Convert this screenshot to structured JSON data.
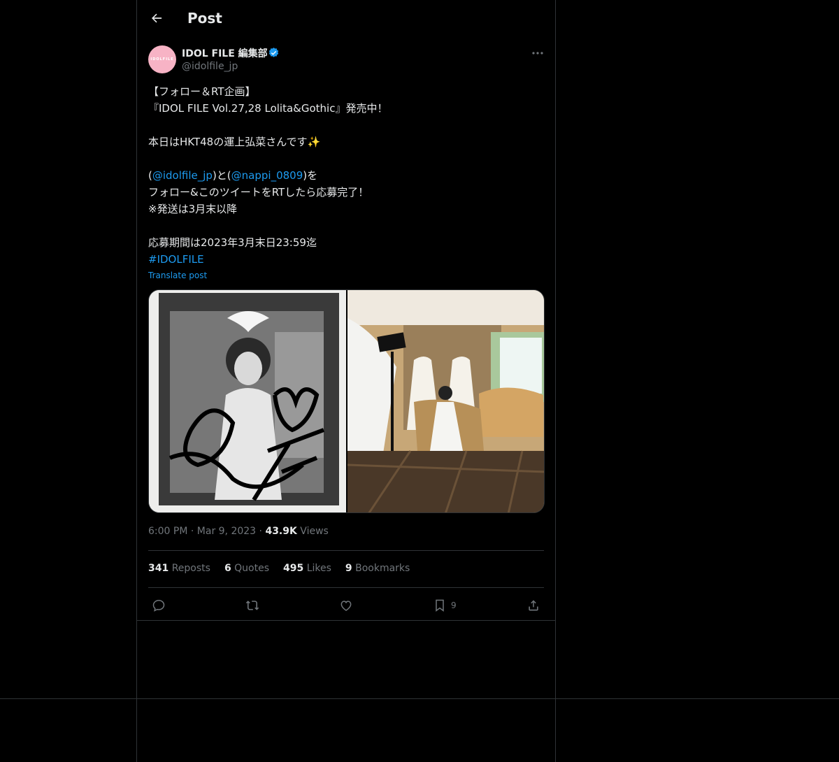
{
  "header": {
    "title": "Post"
  },
  "author": {
    "display_name": "IDOL FILE 編集部",
    "handle": "@idolfile_jp",
    "avatar_text": "IDOLFILE"
  },
  "post": {
    "line1": "【フォロー＆RT企画】",
    "line2": "『IDOL FILE Vol.27,28 Lolita&Gothic』発売中！",
    "line3": "本日はHKT48の運上弘菜さんです",
    "line3_emoji": "✨",
    "line4_pre": "(",
    "mention1": "@idolfile_jp",
    "line4_mid": ")と(",
    "mention2": "@nappi_0809",
    "line4_post": ")を",
    "line5": "フォロー&このツイートをRTしたら応募完了！",
    "line6": "※発送は3月末以降",
    "line7": "応募期間は2023年3月末日23:59迄",
    "hashtag": "#IDOLFILE",
    "translate_label": "Translate post"
  },
  "meta": {
    "time": "6:00 PM",
    "sep": "·",
    "date": "Mar 9, 2023",
    "views_count": "43.9K",
    "views_label": "Views"
  },
  "stats": {
    "reposts_count": "341",
    "reposts_label": "Reposts",
    "quotes_count": "6",
    "quotes_label": "Quotes",
    "likes_count": "495",
    "likes_label": "Likes",
    "bookmarks_count": "9",
    "bookmarks_label": "Bookmarks"
  },
  "actions": {
    "bookmark_count": "9"
  },
  "colors": {
    "accent": "#1d9bf0",
    "muted": "#71767b",
    "border": "#2f3336",
    "text": "#e7e9ea"
  }
}
